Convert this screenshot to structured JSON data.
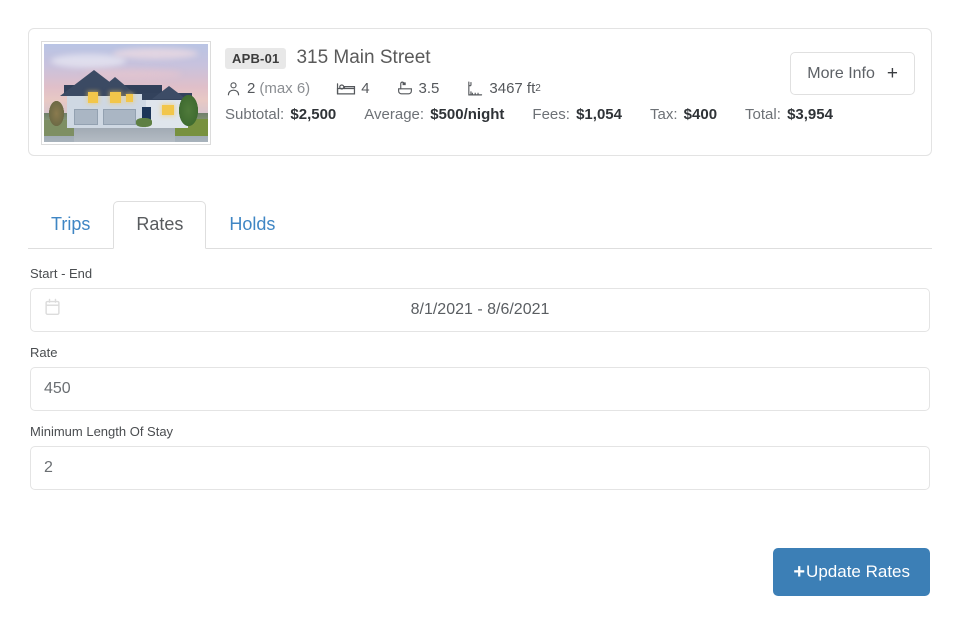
{
  "property": {
    "badge": "APB-01",
    "address": "315 Main Street",
    "thumbnail_alt": "house-photo",
    "specs": [
      {
        "icon": "person-icon",
        "value": "2",
        "note": "(max 6)"
      },
      {
        "icon": "bed-icon",
        "value": "4",
        "note": ""
      },
      {
        "icon": "bathtub-icon",
        "value": "3.5",
        "note": ""
      },
      {
        "icon": "ruler-icon",
        "value": "3467 ft",
        "note": ""
      }
    ],
    "area_superscript": "2",
    "money": [
      {
        "label": "Subtotal:",
        "value": "$2,500"
      },
      {
        "label": "Average:",
        "value": "$500/night"
      },
      {
        "label": "Fees:",
        "value": "$1,054"
      },
      {
        "label": "Tax:",
        "value": "$400"
      },
      {
        "label": "Total:",
        "value": "$3,954"
      }
    ],
    "more_info_label": "More Info",
    "more_info_plus": "+"
  },
  "tabs": [
    {
      "label": "Trips",
      "active": false
    },
    {
      "label": "Rates",
      "active": true
    },
    {
      "label": "Holds",
      "active": false
    }
  ],
  "form": {
    "date_range": {
      "label": "Start - End",
      "value": "8/1/2021 - 8/6/2021",
      "icon": "calendar-icon"
    },
    "rate": {
      "label": "Rate",
      "value": "450"
    },
    "min_stay": {
      "label": "Minimum Length Of Stay",
      "value": "2"
    }
  },
  "actions": {
    "update_plus": "+",
    "update_label": "Update Rates"
  },
  "colors": {
    "link_blue": "#3f86c4",
    "button_blue": "#3c7fb6",
    "border_gray": "#e4e4e4",
    "badge_gray": "#e8e8e8",
    "text_dark": "#2f3337",
    "text_muted": "#6d7176"
  }
}
